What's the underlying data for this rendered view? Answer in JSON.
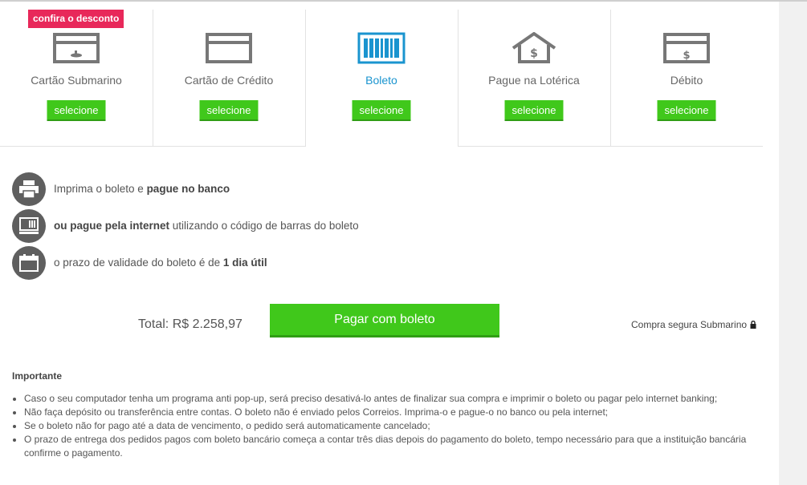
{
  "tabs": [
    {
      "label": "Cartão Submarino",
      "button": "selecione",
      "icon": "submarino-card-icon"
    },
    {
      "label": "Cartão de Crédito",
      "button": "selecione",
      "icon": "credit-card-icon"
    },
    {
      "label": "Boleto",
      "button": "selecione",
      "icon": "barcode-icon",
      "active": true
    },
    {
      "label": "Pague na Lotérica",
      "button": "selecione",
      "icon": "house-dollar-icon"
    },
    {
      "label": "Débito",
      "button": "selecione",
      "icon": "debit-card-icon"
    }
  ],
  "badge": "confira o desconto",
  "info": {
    "row1": {
      "text": "Imprima o boleto e ",
      "bold": "pague no banco"
    },
    "row2": {
      "bold": "ou pague pela internet",
      "text": " utilizando o código de barras do boleto"
    },
    "row3": {
      "text": "o prazo de validade do boleto é de ",
      "bold": "1 dia útil"
    }
  },
  "payment": {
    "total_label": "Total: R$ 2.258,97",
    "pay_button": "Pagar com boleto",
    "secure_label": "Compra segura Submarino"
  },
  "importante": {
    "title": "Importante",
    "items": [
      "Caso o seu computador tenha um programa anti pop-up, será preciso desativá-lo antes de finalizar sua compra e imprimir o boleto ou pagar pelo internet banking;",
      "Não faça depósito ou transferência entre contas. O boleto não é enviado pelos Correios. Imprima-o e pague-o no banco ou pela internet;",
      "Se o boleto não for pago até a data de vencimento, o pedido será automaticamente cancelado;",
      "O prazo de entrega dos pedidos pagos com boleto bancário começa a contar três dias depois do pagamento do boleto, tempo necessário para que a instituição bancária confirme o pagamento."
    ]
  },
  "colors": {
    "accent_green": "#40c81b",
    "active_blue": "#1a94cf",
    "badge_red": "#e8285a",
    "icon_gray": "#666666"
  }
}
